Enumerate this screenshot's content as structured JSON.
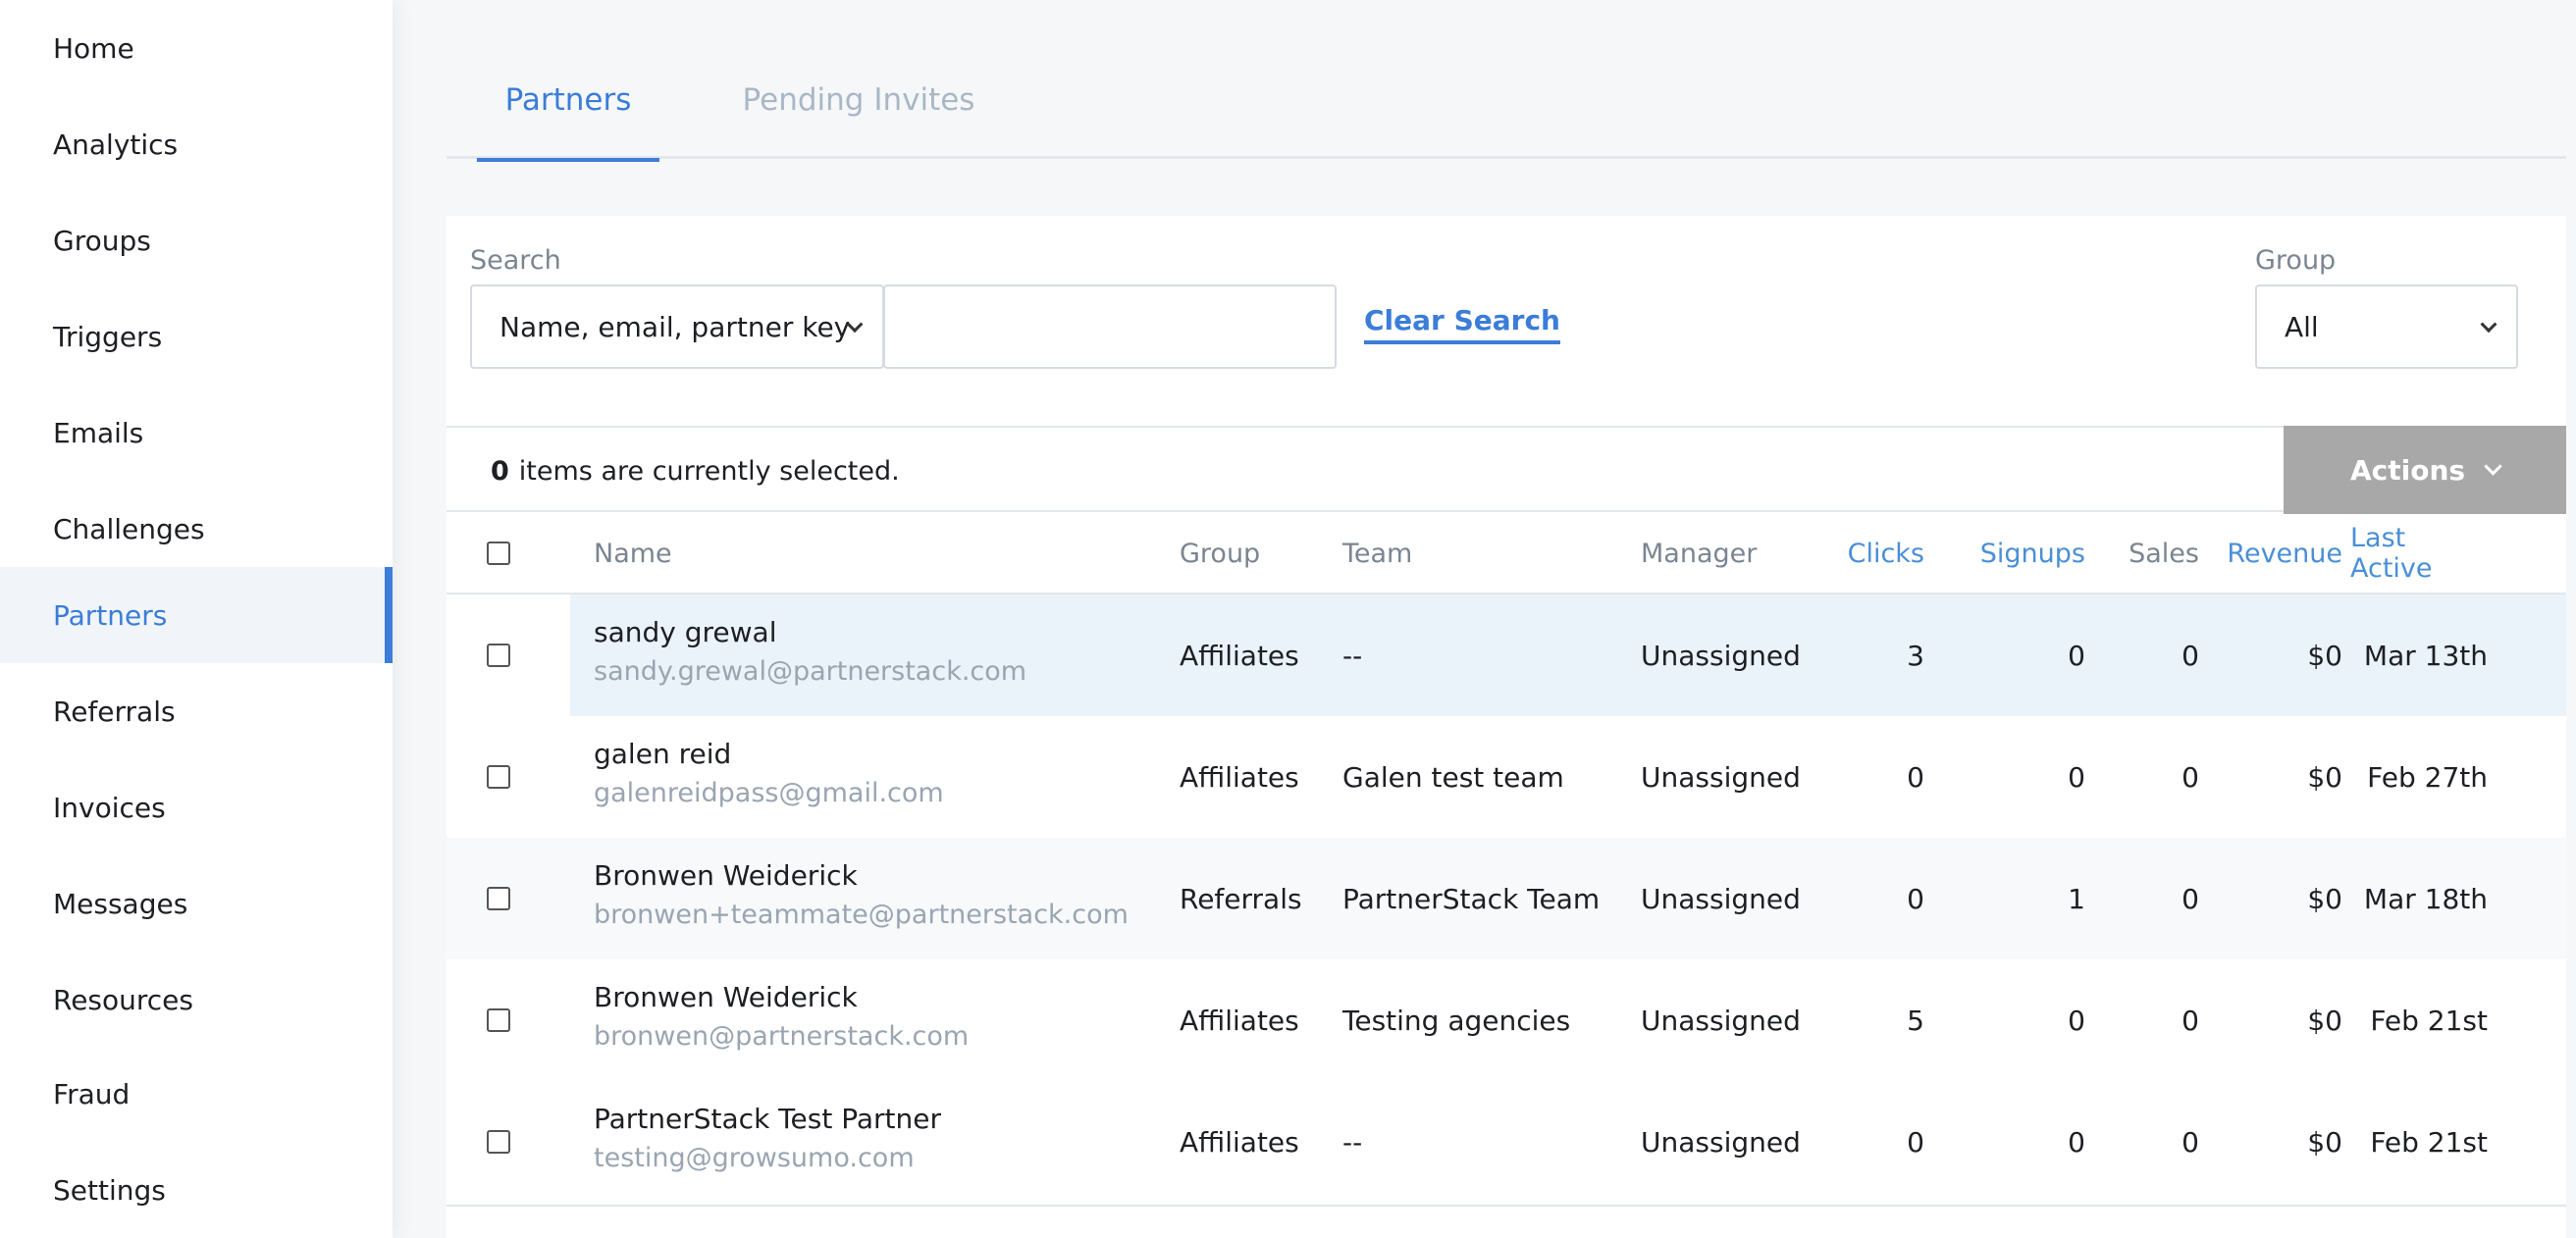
{
  "sidebar": {
    "items": [
      {
        "label": "Home"
      },
      {
        "label": "Analytics"
      },
      {
        "label": "Groups"
      },
      {
        "label": "Triggers"
      },
      {
        "label": "Emails"
      },
      {
        "label": "Challenges"
      },
      {
        "label": "Partners",
        "active": true
      },
      {
        "label": "Referrals"
      },
      {
        "label": "Invoices"
      },
      {
        "label": "Messages"
      },
      {
        "label": "Resources"
      },
      {
        "label": "Fraud"
      },
      {
        "label": "Settings"
      }
    ]
  },
  "tabs": [
    {
      "label": "Partners",
      "active": true
    },
    {
      "label": "Pending Invites",
      "active": false
    }
  ],
  "filters": {
    "search_label": "Search",
    "search_field_selected": "Name, email, partner key",
    "search_value": "",
    "clear_search": "Clear Search",
    "group_label": "Group",
    "group_selected": "All"
  },
  "selection": {
    "count": "0",
    "text": "items are currently selected.",
    "actions_label": "Actions"
  },
  "table": {
    "columns": {
      "name": "Name",
      "group": "Group",
      "team": "Team",
      "manager": "Manager",
      "clicks": "Clicks",
      "signups": "Signups",
      "sales": "Sales",
      "revenue": "Revenue",
      "last_active": "Last Active"
    },
    "rows": [
      {
        "name": "sandy grewal",
        "email": "sandy.grewal@partnerstack.com",
        "group": "Affiliates",
        "team": "--",
        "manager": "Unassigned",
        "clicks": "3",
        "signups": "0",
        "sales": "0",
        "revenue": "$0",
        "last_active": "Mar 13th"
      },
      {
        "name": "galen reid",
        "email": "galenreidpass@gmail.com",
        "group": "Affiliates",
        "team": "Galen test team",
        "manager": "Unassigned",
        "clicks": "0",
        "signups": "0",
        "sales": "0",
        "revenue": "$0",
        "last_active": "Feb 27th"
      },
      {
        "name": "Bronwen Weiderick",
        "email": "bronwen+teammate@partnerstack.com",
        "group": "Referrals",
        "team": "PartnerStack Team",
        "manager": "Unassigned",
        "clicks": "0",
        "signups": "1",
        "sales": "0",
        "revenue": "$0",
        "last_active": "Mar 18th"
      },
      {
        "name": "Bronwen Weiderick",
        "email": "bronwen@partnerstack.com",
        "group": "Affiliates",
        "team": "Testing agencies",
        "manager": "Unassigned",
        "clicks": "5",
        "signups": "0",
        "sales": "0",
        "revenue": "$0",
        "last_active": "Feb 21st"
      },
      {
        "name": "PartnerStack Test Partner",
        "email": "testing@growsumo.com",
        "group": "Affiliates",
        "team": "--",
        "manager": "Unassigned",
        "clicks": "0",
        "signups": "0",
        "sales": "0",
        "revenue": "$0",
        "last_active": "Feb 21st"
      }
    ]
  },
  "colors": {
    "accent": "#3b7dd8",
    "actions_bg": "#a8a8a8",
    "highlight_row": "#eaf2fa"
  }
}
